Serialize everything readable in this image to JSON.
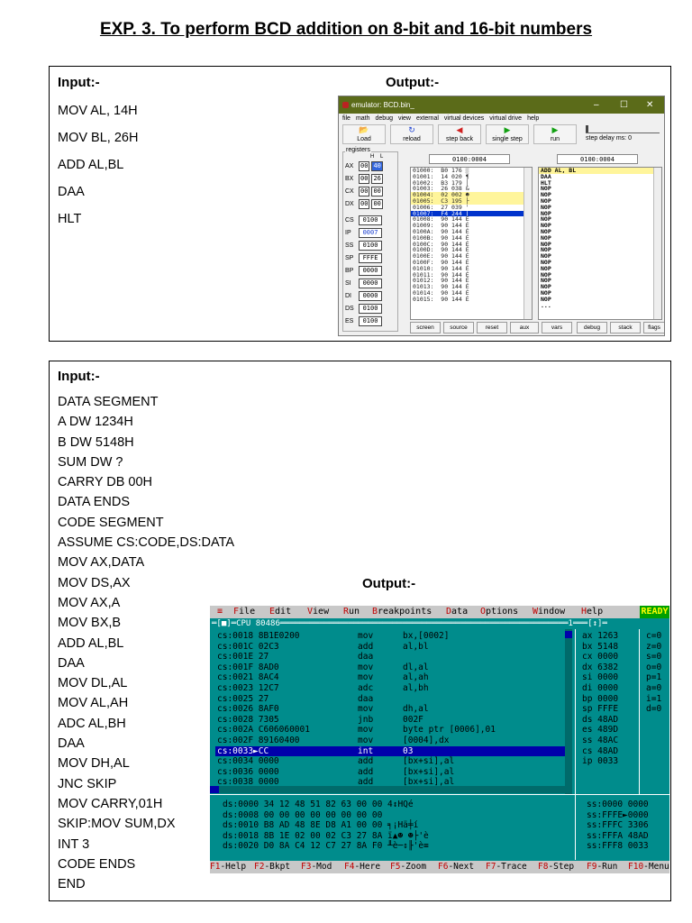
{
  "title": "EXP. 3. To perform BCD addition on 8-bit and 16-bit numbers",
  "section1": {
    "input_label": "Input:-",
    "output_label": "Output:-",
    "code": [
      "MOV AL, 14H",
      "MOV BL, 26H",
      "ADD AL,BL",
      "DAA",
      "HLT"
    ]
  },
  "emulator": {
    "title": "emulator: BCD.bin_",
    "window_controls": [
      "–",
      "☐",
      "✕"
    ],
    "menu": [
      "file",
      "math",
      "debug",
      "view",
      "external",
      "virtual devices",
      "virtual drive",
      "help"
    ],
    "toolbar": [
      {
        "label": "Load",
        "icon": "folder-icon",
        "glyph": "📂",
        "color": "#b8860b"
      },
      {
        "label": "reload",
        "icon": "reload-icon",
        "glyph": "↻",
        "color": "#1a3fd0"
      },
      {
        "label": "step back",
        "icon": "step-back-icon",
        "glyph": "◀",
        "color": "#d02020"
      },
      {
        "label": "single step",
        "icon": "single-step-icon",
        "glyph": "▶",
        "color": "#12a012"
      },
      {
        "label": "run",
        "icon": "run-icon",
        "glyph": "▶",
        "color": "#12a012"
      }
    ],
    "step_delay": "step delay ms: 0",
    "registers_label": "registers",
    "hl_label": "H    L",
    "registers": [
      {
        "name": "AX",
        "h": "00",
        "l": "40"
      },
      {
        "name": "BX",
        "h": "00",
        "l": "26"
      },
      {
        "name": "CX",
        "h": "00",
        "l": "00"
      },
      {
        "name": "DX",
        "h": "00",
        "l": "00"
      }
    ],
    "seg_registers": [
      {
        "name": "CS",
        "value": "0100"
      },
      {
        "name": "IP",
        "value": "0007"
      },
      {
        "name": "SS",
        "value": "0100"
      },
      {
        "name": "SP",
        "value": "FFFE"
      },
      {
        "name": "BP",
        "value": "0000"
      },
      {
        "name": "SI",
        "value": "0000"
      },
      {
        "name": "DI",
        "value": "0000"
      },
      {
        "name": "DS",
        "value": "0100"
      },
      {
        "name": "ES",
        "value": "0100"
      }
    ],
    "addr_left": "0100:0004",
    "addr_right": "0100:0004",
    "memory": [
      "01000:  B0 176 ░",
      "01001:  14 020 ¶",
      "01002:  B3 179 │",
      "01003:  26 038 &",
      "01004:  02 002 ☻",
      "01005:  C3 195 ├",
      "01006:  27 039 '",
      "01007:  F4 244 ⌠",
      "01008:  90 144 É",
      "01009:  90 144 É",
      "0100A:  90 144 É",
      "0100B:  90 144 É",
      "0100C:  90 144 É",
      "0100D:  90 144 É",
      "0100E:  90 144 É",
      "0100F:  90 144 É",
      "01010:  90 144 É",
      "01011:  90 144 É",
      "01012:  90 144 É",
      "01013:  90 144 É",
      "01014:  90 144 É",
      "01015:  90 144 É"
    ],
    "disasm": [
      "ADD AL, BL",
      "DAA",
      "HLT",
      "NOP",
      "NOP",
      "NOP",
      "NOP",
      "NOP",
      "NOP",
      "NOP",
      "NOP",
      "NOP",
      "NOP",
      "NOP",
      "NOP",
      "NOP",
      "NOP",
      "NOP",
      "NOP",
      "NOP",
      "NOP",
      "NOP",
      "..."
    ],
    "bottom_buttons": [
      "screen",
      "source",
      "reset",
      "aux",
      "vars",
      "debug",
      "stack",
      "flags"
    ]
  },
  "section2": {
    "input_label": "Input:-",
    "output_label": "Output:-",
    "code": [
      "DATA SEGMENT",
      "A DW 1234H",
      "B DW 5148H",
      "SUM DW ?",
      "CARRY DB 00H",
      "DATA ENDS",
      "CODE SEGMENT",
      "ASSUME CS:CODE,DS:DATA",
      "MOV AX,DATA",
      "MOV DS,AX",
      "MOV AX,A",
      "MOV BX,B",
      "ADD AL,BL",
      "DAA",
      "MOV DL,AL",
      "MOV AL,AH",
      "ADC AL,BH",
      "DAA",
      "MOV DH,AL",
      "JNC SKIP",
      "MOV CARRY,01H",
      "SKIP:MOV SUM,DX",
      "INT 3",
      "CODE ENDS",
      "END"
    ]
  },
  "debugger": {
    "menu": [
      "≡",
      "File",
      "Edit",
      "View",
      "Run",
      "Breakpoints",
      "Data",
      "Options",
      "Window",
      "Help"
    ],
    "ready": "READY",
    "cpu_header": "═[■]═CPU 80486═══════════════════════════════════════════════════════════1═══[↕]═",
    "code_rows": [
      {
        "addr": "cs:0018 8B1E0200",
        "op": "mov",
        "arg": "bx,[0002]"
      },
      {
        "addr": "cs:001C 02C3",
        "op": "add",
        "arg": "al,bl"
      },
      {
        "addr": "cs:001E 27",
        "op": "daa",
        "arg": ""
      },
      {
        "addr": "cs:001F 8AD0",
        "op": "mov",
        "arg": "dl,al"
      },
      {
        "addr": "cs:0021 8AC4",
        "op": "mov",
        "arg": "al,ah"
      },
      {
        "addr": "cs:0023 12C7",
        "op": "adc",
        "arg": "al,bh"
      },
      {
        "addr": "cs:0025 27",
        "op": "daa",
        "arg": ""
      },
      {
        "addr": "cs:0026 8AF0",
        "op": "mov",
        "arg": "dh,al"
      },
      {
        "addr": "cs:0028 7305",
        "op": "jnb",
        "arg": "002F"
      },
      {
        "addr": "cs:002A C606060001",
        "op": "mov",
        "arg": "byte ptr [0006],01"
      },
      {
        "addr": "cs:002F 89160400",
        "op": "mov",
        "arg": "[0004],dx"
      },
      {
        "addr": "cs:0033►CC",
        "op": "int",
        "arg": "03"
      },
      {
        "addr": "cs:0034 0000",
        "op": "add",
        "arg": "[bx+si],al"
      },
      {
        "addr": "cs:0036 0000",
        "op": "add",
        "arg": "[bx+si],al"
      },
      {
        "addr": "cs:0038 0000",
        "op": "add",
        "arg": "[bx+si],al"
      }
    ],
    "registers": [
      "ax 1263",
      "bx 5148",
      "cx 0000",
      "dx 6382",
      "si 0000",
      "di 0000",
      "bp 0000",
      "sp FFFE",
      "ds 48AD",
      "es 489D",
      "ss 48AC",
      "cs 48AD",
      "ip 0033"
    ],
    "flags": [
      "c=0",
      "z=0",
      "s=0",
      "o=0",
      "p=1",
      "a=0",
      "i=1",
      "d=0"
    ],
    "dump": [
      "ds:0000 34 12 48 51 82 63 00 00 4↕HQé",
      "ds:0008 00 00 00 00 00 00 00 00",
      "ds:0010 B8 AD 48 8E D8 A1 00 00 ╕¡Hä╪í",
      "ds:0018 8B 1E 02 00 02 C3 27 8A ï▲☻ ☻├'è",
      "ds:0020 D0 8A C4 12 C7 27 8A F0 ╨è─↕╟'è≡"
    ],
    "stack": [
      "ss:0000 0000",
      "ss:FFFE►0000",
      "ss:FFFC 3306",
      "ss:FFFA 48AD",
      "ss:FFF8 0033"
    ],
    "fkeys": [
      {
        "k": "F1",
        "t": "-Help"
      },
      {
        "k": "F2",
        "t": "-Bkpt"
      },
      {
        "k": "F3",
        "t": "-Mod"
      },
      {
        "k": "F4",
        "t": "-Here"
      },
      {
        "k": "F5",
        "t": "-Zoom"
      },
      {
        "k": "F6",
        "t": "-Next"
      },
      {
        "k": "F7",
        "t": "-Trace"
      },
      {
        "k": "F8",
        "t": "-Step"
      },
      {
        "k": "F9",
        "t": "-Run"
      },
      {
        "k": "F10",
        "t": "-Menu"
      }
    ]
  }
}
